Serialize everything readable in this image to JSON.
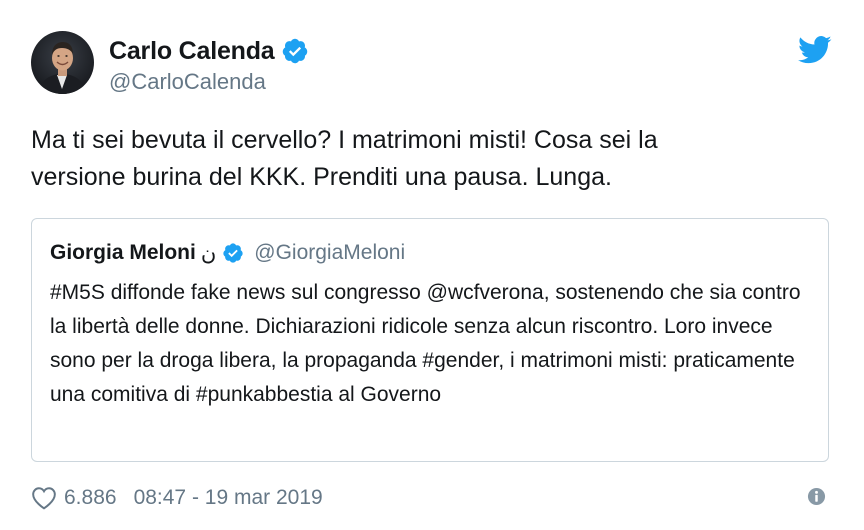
{
  "author": {
    "display_name": "Carlo Calenda",
    "handle": "@CarloCalenda",
    "verified": true
  },
  "tweet": {
    "text": "Ma ti sei bevuta il cervello? I matrimoni misti! Cosa sei la\nversione burina del KKK. Prenditi una pausa. Lunga."
  },
  "quoted_tweet": {
    "display_name": "Giorgia Meloni",
    "name_suffix": "ن",
    "handle": "@GiorgiaMeloni",
    "verified": true,
    "text": "#M5S diffonde fake news sul congresso @wcfverona, sostenendo che sia contro la libertà delle donne. Dichiarazioni ridicole senza alcun riscontro. Loro invece sono per la droga libera, la propaganda #gender, i matrimoni misti: praticamente una comitiva di #punkabbestia al Governo"
  },
  "footer": {
    "likes": "6.886",
    "timestamp": "08:47 - 19 mar 2019"
  },
  "icons": {
    "brand": "twitter-bird-icon",
    "verified": "verified-badge-icon",
    "like": "heart-icon",
    "info": "info-icon"
  },
  "colors": {
    "twitter_blue": "#1da1f2",
    "text": "#14171a",
    "secondary": "#657786",
    "border": "#ccd6dd"
  }
}
